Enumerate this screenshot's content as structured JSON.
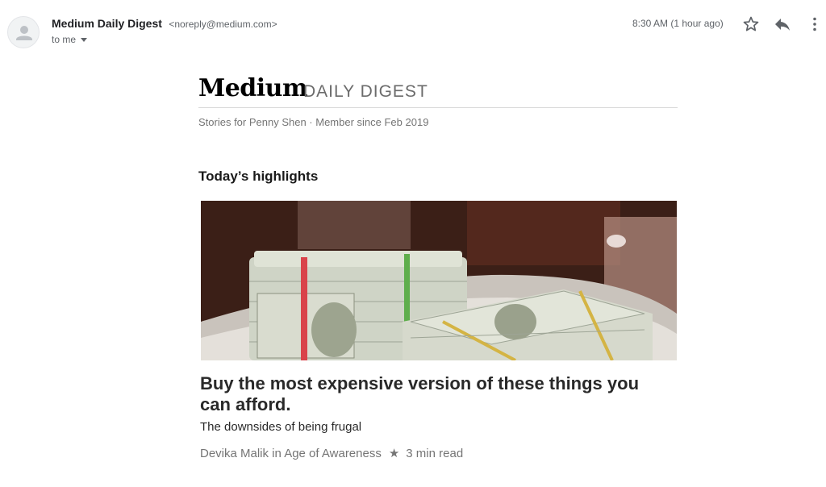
{
  "email": {
    "sender_name": "Medium Daily Digest",
    "sender_email": "<noreply@medium.com>",
    "recipient": "to me",
    "timestamp": "8:30 AM (1 hour ago)"
  },
  "icons": {
    "avatar": "person-icon",
    "star": "star-outline-icon",
    "reply": "reply-icon",
    "more": "more-vertical-icon"
  },
  "digest": {
    "brand": "Medium",
    "edition": "DAILY DIGEST",
    "member_line": "Stories for Penny Shen · Member since Feb 2019",
    "section_title": "Today’s highlights"
  },
  "story": {
    "title": "Buy the most expensive version of these things you can afford.",
    "subtitle": "The downsides of being frugal",
    "author": "Devika Malik in Age of Awareness",
    "separator": "★",
    "read_time": "3 min read"
  },
  "colors": {
    "text_primary": "#202124",
    "text_secondary": "#5f6368",
    "story_text": "#292929",
    "muted": "#757575"
  }
}
